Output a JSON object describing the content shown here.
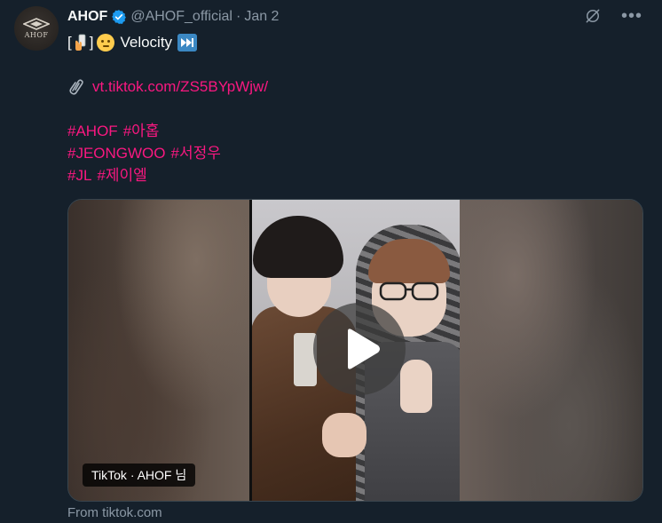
{
  "tweet": {
    "author_name": "AHOF",
    "handle": "@AHOF_official",
    "separator": "·",
    "date": "Jan 2",
    "avatar_text": "AHOF",
    "line1_open": "[",
    "line1_close": "]",
    "line1_text": "Velocity",
    "link_text": "vt.tiktok.com/ZS5BYpWjw/",
    "hashtags_row1": [
      "#AHOF",
      "#아홉"
    ],
    "hashtags_row2": [
      "#JEONGWOO",
      "#서정우"
    ],
    "hashtags_row3": [
      "#JL",
      "#제이엘"
    ]
  },
  "media": {
    "source_label": "TikTok · AHOF 님",
    "from_text": "From tiktok.com"
  },
  "icons": {
    "verified": "verified-badge-icon",
    "grok": "grok-icon",
    "more": "more-icon",
    "play": "play-icon",
    "paperclip": "paperclip-icon"
  },
  "colors": {
    "background": "#15202b",
    "hashtag": "#f91880",
    "secondary_text": "#8b98a5",
    "verified": "#1d9bf0"
  }
}
